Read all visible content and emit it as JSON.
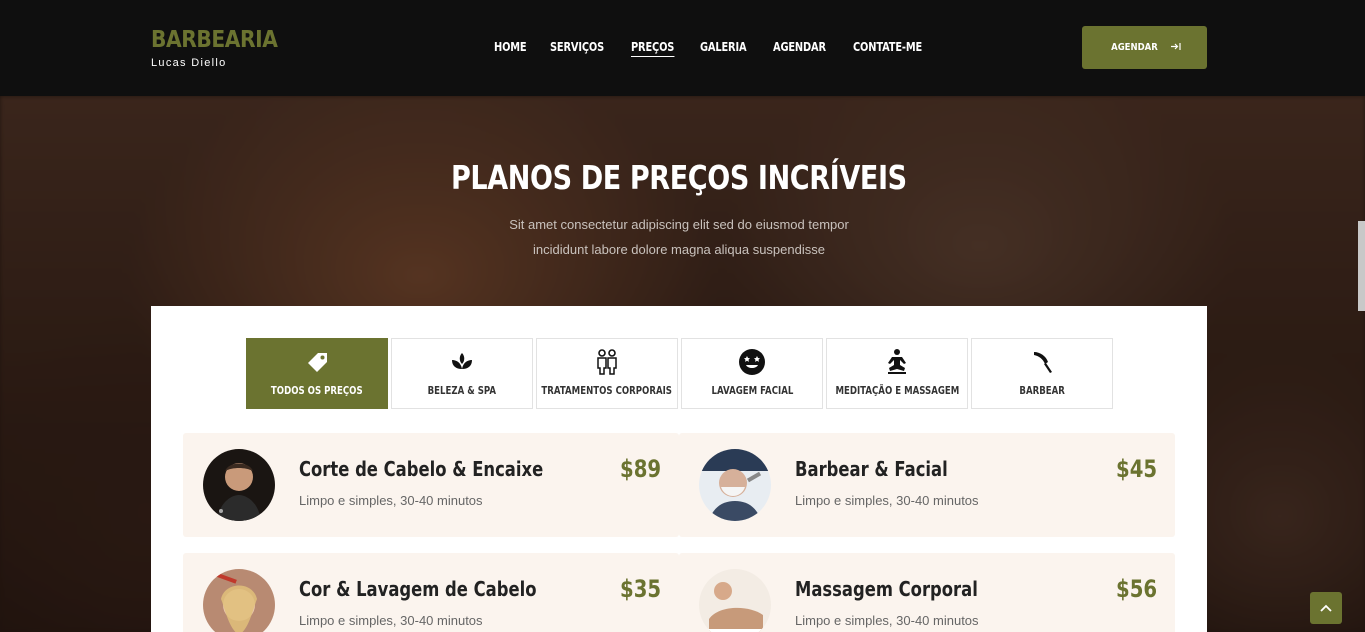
{
  "brand": {
    "title": "BARBEARIA",
    "subtitle": "Lucas Diello"
  },
  "nav": {
    "items": [
      "HOME",
      "SERVIÇOS",
      "PREÇOS",
      "GALERIA",
      "AGENDAR",
      "CONTATE-ME"
    ],
    "active": "PREÇOS"
  },
  "cta": {
    "label": "AGENDAR",
    "icon": "arrow-right-to-bracket-icon"
  },
  "hero": {
    "title": "PLANOS DE PREÇOS INCRÍVEIS",
    "subtitle_line1": "Sit amet consectetur adipiscing elit sed do eiusmod tempor",
    "subtitle_line2": "incididunt labore dolore magna aliqua suspendisse"
  },
  "tabs": [
    {
      "label": "TODOS OS PREÇOS",
      "icon": "tag-icon",
      "active": true
    },
    {
      "label": "BELEZA & SPA",
      "icon": "spa-icon",
      "active": false
    },
    {
      "label": "TRATAMENTOS CORPORAIS",
      "icon": "people-icon",
      "active": false
    },
    {
      "label": "LAVAGEM FACIAL",
      "icon": "star-eyes-face-icon",
      "active": false
    },
    {
      "label": "MEDITAÇÃO E MASSAGEM",
      "icon": "meditation-icon",
      "active": false
    },
    {
      "label": "BARBEAR",
      "icon": "razor-icon",
      "active": false
    }
  ],
  "services": [
    {
      "title": "Corte de Cabelo & Encaixe",
      "desc": "Limpo e simples, 30-40 minutos",
      "price": "$89"
    },
    {
      "title": "Barbear & Facial",
      "desc": "Limpo e simples, 30-40 minutos",
      "price": "$45"
    },
    {
      "title": "Cor & Lavagem de Cabelo",
      "desc": "Limpo e simples, 30-40 minutos",
      "price": "$35"
    },
    {
      "title": "Massagem Corporal",
      "desc": "Limpo e simples, 30-40 minutos",
      "price": "$56"
    }
  ],
  "colors": {
    "accent": "#6b7330",
    "header_bg": "#0f0f0f",
    "card_bg": "#fbf4ee"
  },
  "back_to_top": {
    "icon": "chevron-up-icon"
  }
}
